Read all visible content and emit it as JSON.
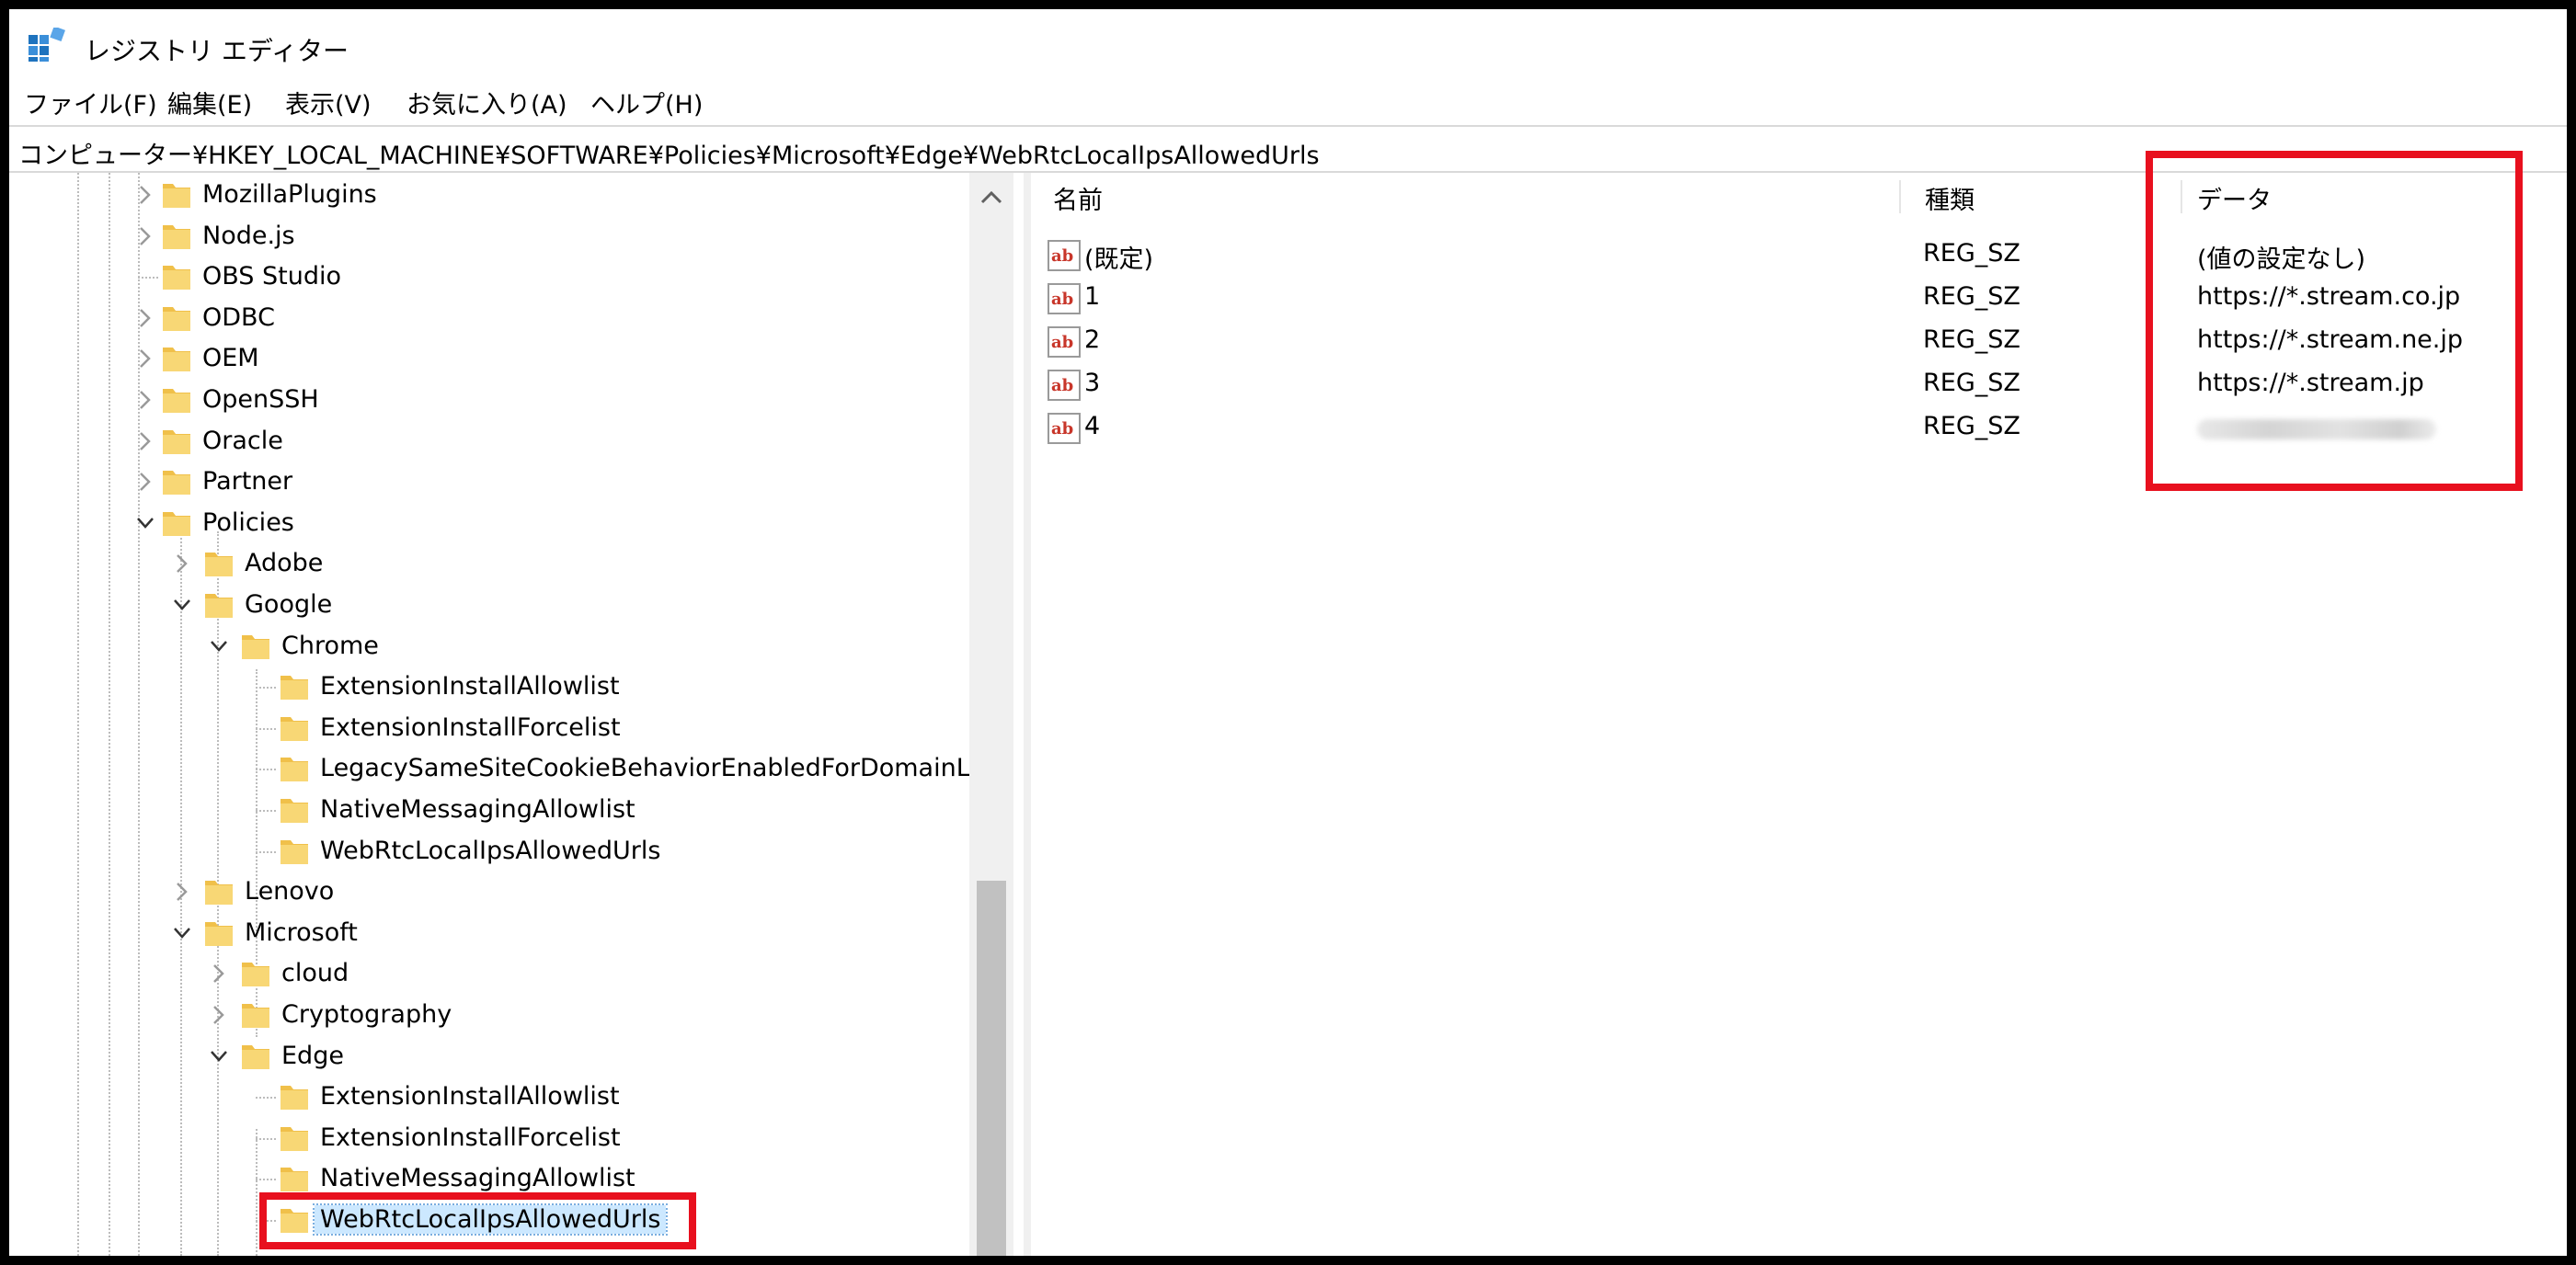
{
  "window": {
    "title": "レジストリ エディター",
    "icon": "registry-editor-icon"
  },
  "menu": [
    "ファイル(F)",
    "編集(E)",
    "表示(V)",
    "お気に入り(A)",
    "ヘルプ(H)"
  ],
  "address": "コンピューター¥HKEY_LOCAL_MACHINE¥SOFTWARE¥Policies¥Microsoft¥Edge¥WebRtcLocalIpsAllowedUrls",
  "tree": {
    "nodes": [
      {
        "label": "MozillaPlugins",
        "expander": "collapsed"
      },
      {
        "label": "Node.js",
        "expander": "collapsed"
      },
      {
        "label": "OBS Studio",
        "expander": "none"
      },
      {
        "label": "ODBC",
        "expander": "collapsed"
      },
      {
        "label": "OEM",
        "expander": "collapsed"
      },
      {
        "label": "OpenSSH",
        "expander": "collapsed"
      },
      {
        "label": "Oracle",
        "expander": "collapsed"
      },
      {
        "label": "Partner",
        "expander": "collapsed"
      },
      {
        "label": "Policies",
        "expander": "expanded"
      },
      {
        "label": "Adobe",
        "expander": "collapsed"
      },
      {
        "label": "Google",
        "expander": "expanded"
      },
      {
        "label": "Chrome",
        "expander": "expanded"
      },
      {
        "label": "ExtensionInstallAllowlist",
        "expander": "none"
      },
      {
        "label": "ExtensionInstallForcelist",
        "expander": "none"
      },
      {
        "label": "LegacySameSiteCookieBehaviorEnabledForDomainList",
        "expander": "none"
      },
      {
        "label": "NativeMessagingAllowlist",
        "expander": "none"
      },
      {
        "label": "WebRtcLocalIpsAllowedUrls",
        "expander": "none"
      },
      {
        "label": "Lenovo",
        "expander": "collapsed"
      },
      {
        "label": "Microsoft",
        "expander": "expanded"
      },
      {
        "label": "cloud",
        "expander": "collapsed"
      },
      {
        "label": "Cryptography",
        "expander": "collapsed"
      },
      {
        "label": "Edge",
        "expander": "expanded"
      },
      {
        "label": "ExtensionInstallAllowlist",
        "expander": "none"
      },
      {
        "label": "ExtensionInstallForcelist",
        "expander": "none"
      },
      {
        "label": "NativeMessagingAllowlist",
        "expander": "none"
      },
      {
        "label": "WebRtcLocalIpsAllowedUrls",
        "expander": "none",
        "selected": true
      }
    ]
  },
  "values": {
    "columns": {
      "name": "名前",
      "type": "種類",
      "data": "データ"
    },
    "rows": [
      {
        "name": "(既定)",
        "type": "REG_SZ",
        "data": "(値の設定なし)"
      },
      {
        "name": "1",
        "type": "REG_SZ",
        "data": "https://*.stream.co.jp"
      },
      {
        "name": "2",
        "type": "REG_SZ",
        "data": "https://*.stream.ne.jp"
      },
      {
        "name": "3",
        "type": "REG_SZ",
        "data": "https://*.stream.jp"
      },
      {
        "name": "4",
        "type": "REG_SZ",
        "data": ""
      }
    ]
  },
  "colors": {
    "highlight": "#e8101e",
    "folder": "#f8d775",
    "selection": "#cce8ff"
  }
}
